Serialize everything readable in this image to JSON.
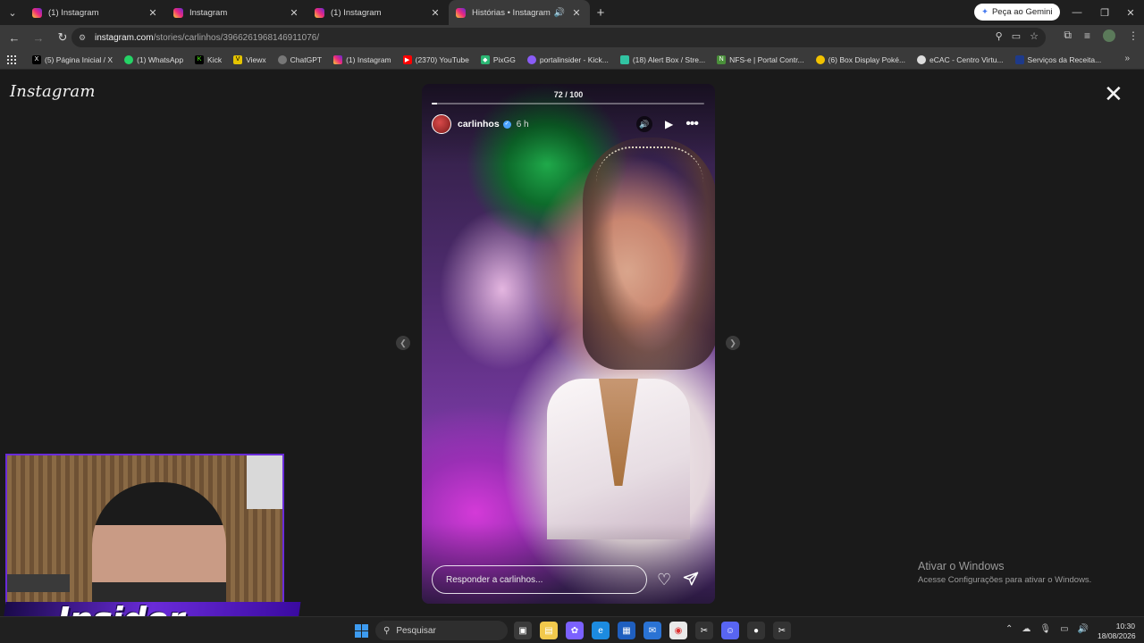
{
  "browser": {
    "tabs": [
      {
        "title": "(1) Instagram",
        "active": false
      },
      {
        "title": "Instagram",
        "active": false
      },
      {
        "title": "(1) Instagram",
        "active": false
      },
      {
        "title": "Histórias • Instagram",
        "active": true
      }
    ],
    "gemini_label": "Peça ao Gemini",
    "url_host": "instagram.com",
    "url_path": "/stories/carlinhos/3966261968146911076/",
    "bookmarks": [
      {
        "label": "(5) Página Inicial / X",
        "icon": "x-icon",
        "color": "#000000"
      },
      {
        "label": "(1) WhatsApp",
        "icon": "whatsapp-icon",
        "color": "#25d366"
      },
      {
        "label": "Kick",
        "icon": "kick-icon",
        "color": "#53fc18"
      },
      {
        "label": "Viewx",
        "icon": "viewx-icon",
        "color": "#e5c400"
      },
      {
        "label": "ChatGPT",
        "icon": "chatgpt-icon",
        "color": "#777777"
      },
      {
        "label": "(1) Instagram",
        "icon": "instagram-icon",
        "color": "#e1306c"
      },
      {
        "label": "(2370) YouTube",
        "icon": "youtube-icon",
        "color": "#ff0000"
      },
      {
        "label": "PixGG",
        "icon": "pixgg-icon",
        "color": "#2bb673"
      },
      {
        "label": "portalinsider - Kick...",
        "icon": "portalinsider-icon",
        "color": "#8a5cf6"
      },
      {
        "label": "(18) Alert Box / Stre...",
        "icon": "alertbox-icon",
        "color": "#31c3a2"
      },
      {
        "label": "NFS-e | Portal Contr...",
        "icon": "nfse-icon",
        "color": "#4a8f3a"
      },
      {
        "label": "(6) Box Display Poké...",
        "icon": "pokemon-icon",
        "color": "#f2c200"
      },
      {
        "label": "eCAC - Centro Virtu...",
        "icon": "ecac-icon",
        "color": "#dddddd"
      },
      {
        "label": "Serviços da Receita...",
        "icon": "receita-icon",
        "color": "#1e3a8a"
      }
    ]
  },
  "page": {
    "logo": "Instagram",
    "story": {
      "counter": "72 / 100",
      "progress": 0.02,
      "username": "carlinhos",
      "time": "6 h",
      "reply_placeholder": "Responder a carlinhos..."
    },
    "watermark": {
      "line1": "Ativar o Windows",
      "line2": "Acesse Configurações para ativar o Windows."
    },
    "overlay_text": "Insider"
  },
  "taskbar": {
    "search_placeholder": "Pesquisar",
    "time": "10:30",
    "date": "18/08/2026"
  }
}
